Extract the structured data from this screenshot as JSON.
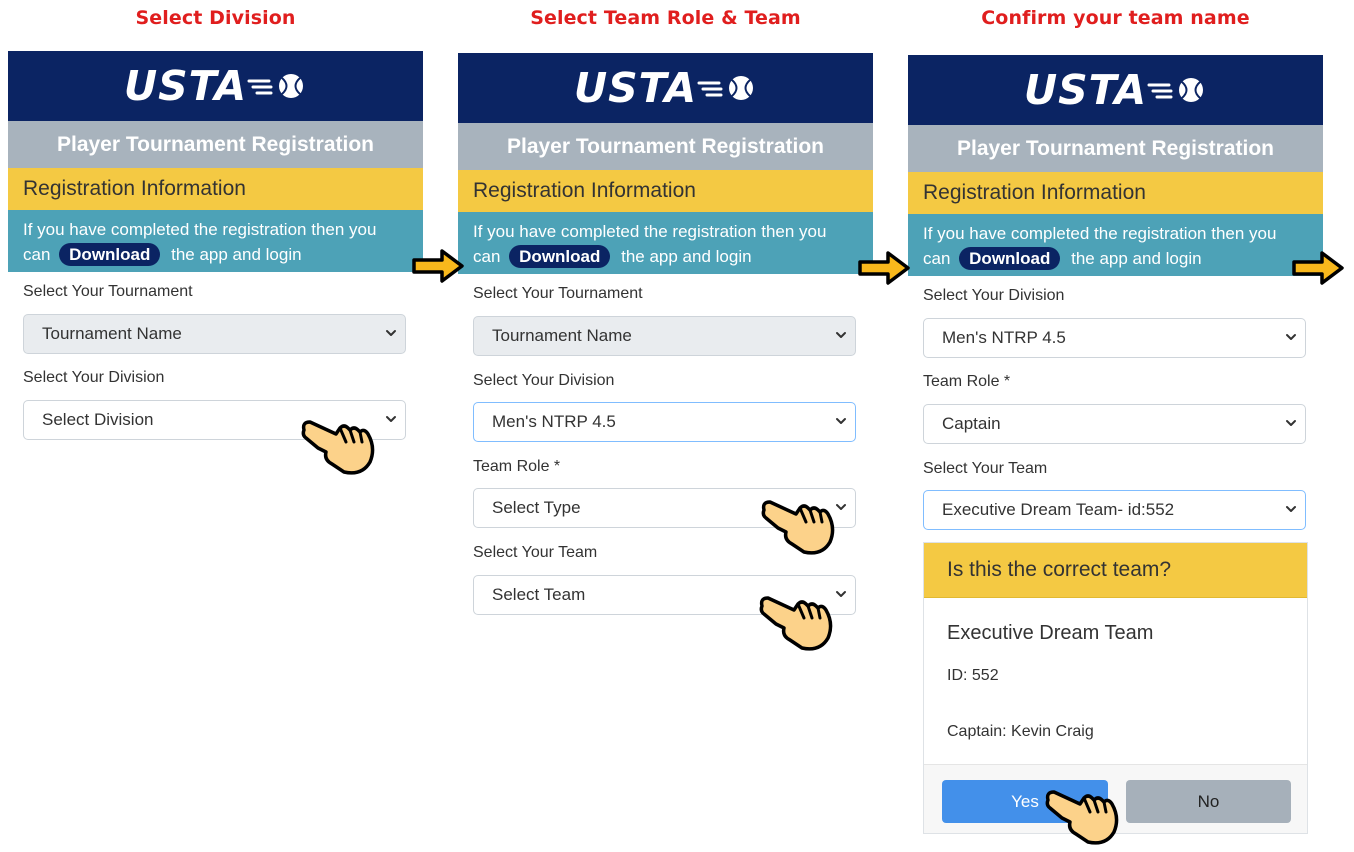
{
  "steps": [
    {
      "title": "Select Division",
      "banner_logo": "USTA",
      "subheader": "Player Tournament Registration",
      "reg_info": "Registration Information",
      "info_line1": "If you have completed the registration then you",
      "info_pre": "can",
      "download_label": "Download",
      "info_post": "the app and login",
      "tournament_label": "Select Your Tournament",
      "tournament_value": "Tournament Name",
      "division_label": "Select Your Division",
      "division_value": "Select Division"
    },
    {
      "title": "Select Team Role & Team",
      "banner_logo": "USTA",
      "subheader": "Player Tournament Registration",
      "reg_info": "Registration Information",
      "info_line1": "If you have completed the registration then you",
      "info_pre": "can",
      "download_label": "Download",
      "info_post": "the app and login",
      "tournament_label": "Select Your Tournament",
      "tournament_value": "Tournament Name",
      "division_label": "Select Your Division",
      "division_value": "Men's NTRP 4.5",
      "role_label": "Team Role *",
      "role_value": "Select Type",
      "team_label": "Select Your Team",
      "team_value": "Select Team"
    },
    {
      "title": "Confirm your team name",
      "banner_logo": "USTA",
      "subheader": "Player Tournament Registration",
      "reg_info": "Registration Information",
      "info_line1": "If you have completed the registration then you",
      "info_pre": "can",
      "download_label": "Download",
      "info_post": "the app and login",
      "division_label": "Select Your Division",
      "division_value": "Men's NTRP 4.5",
      "role_label": "Team Role *",
      "role_value": "Captain",
      "team_label": "Select Your Team",
      "team_value": "Executive Dream Team- id:552",
      "modal": {
        "title": "Is this the correct team?",
        "team_name": "Executive Dream Team",
        "id_line": "ID: 552",
        "captain_line": "Captain: Kevin Craig",
        "yes_label": "Yes",
        "no_label": "No"
      }
    }
  ],
  "colors": {
    "title_red": "#e01e1e",
    "banner_navy": "#0b2463",
    "subheader_gray": "#a8b3bd",
    "reg_yellow": "#f4c943",
    "info_teal": "#4da2b7",
    "yes_blue": "#4390ea",
    "no_gray": "#a6b0ba",
    "arrow_gold": "#f8b81c",
    "hand_skin": "#fcd28a"
  },
  "icons": {
    "arrow": "arrow-right-icon",
    "hand": "pointing-hand-icon",
    "chevron": "chevron-down-icon",
    "tennis_ball": "tennis-ball-icon"
  }
}
